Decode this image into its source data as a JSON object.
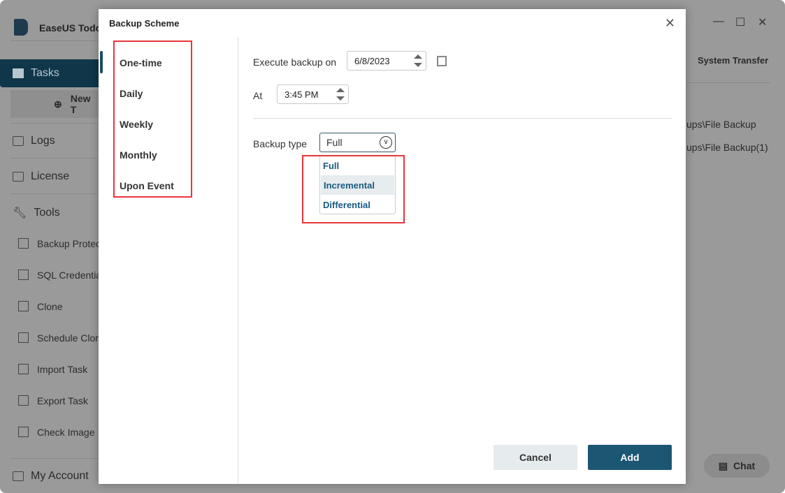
{
  "app": {
    "brand": "EaseUS Todo",
    "nav": {
      "tasks": "Tasks",
      "new_task": "New T",
      "logs": "Logs",
      "license": "License",
      "tools": "Tools",
      "my_account": "My Account"
    },
    "tools": [
      "Backup Protec",
      "SQL Credentia",
      "Clone",
      "Schedule Clone",
      "Import Task",
      "Export Task",
      "Check Image"
    ],
    "system_transfer": "System Transfer",
    "paths": [
      "ups\\File Backup",
      "ups\\File Backup(1)"
    ],
    "chat": "Chat"
  },
  "dialog": {
    "title": "Backup Scheme",
    "schedules": [
      "One-time",
      "Daily",
      "Weekly",
      "Monthly",
      "Upon Event"
    ],
    "execute_label": "Execute backup on",
    "date": "6/8/2023",
    "at_label": "At",
    "time": "3:45 PM",
    "backup_type_label": "Backup type",
    "backup_type": "Full",
    "options": [
      "Full",
      "Incremental",
      "Differential"
    ],
    "cancel": "Cancel",
    "add": "Add"
  }
}
